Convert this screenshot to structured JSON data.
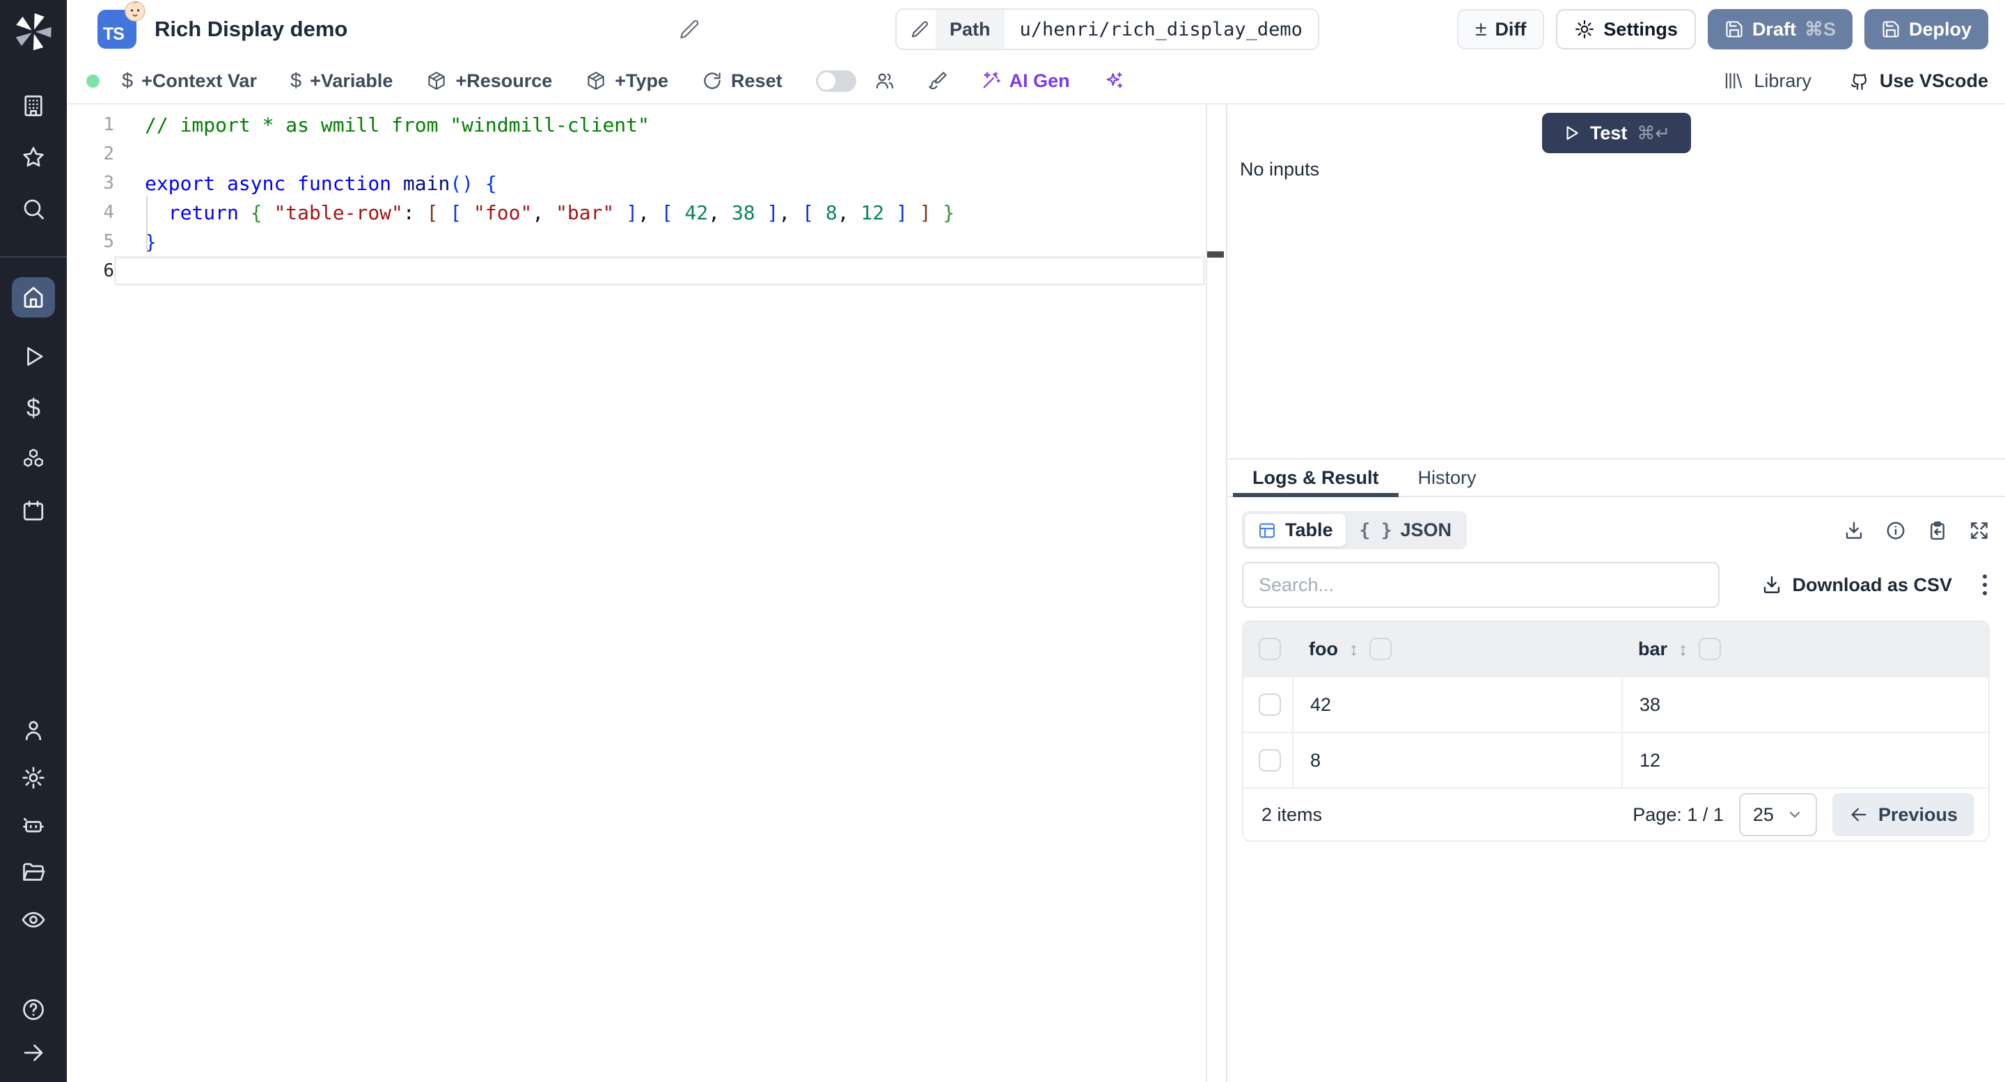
{
  "app": {
    "title": "Rich Display demo",
    "lang_badge": "TS"
  },
  "topbar": {
    "path_label": "Path",
    "path_value": "u/henri/rich_display_demo",
    "diff_label": "Diff",
    "settings_label": "Settings",
    "draft_label": "Draft",
    "draft_shortcut": "⌘S",
    "deploy_label": "Deploy"
  },
  "toolbar": {
    "context_var": "+Context Var",
    "variable": "+Variable",
    "resource": "+Resource",
    "type": "+Type",
    "reset": "Reset",
    "ai_gen": "AI Gen",
    "library": "Library",
    "vscode": "Use VScode"
  },
  "editor": {
    "token_colors": {
      "comment": "#008000",
      "kw": "#0000ff",
      "fn": "#001080",
      "str": "#a31515",
      "num": "#098658",
      "b1": "#0431fa",
      "b2": "#319331",
      "b3": "#7b3814",
      "plain": "#111111"
    },
    "lines": [
      {
        "num": "1",
        "active": false,
        "tokens": [
          [
            "// import * as wmill from \"windmill-client\"",
            "comment"
          ]
        ]
      },
      {
        "num": "2",
        "active": false,
        "tokens": []
      },
      {
        "num": "3",
        "active": false,
        "tokens": [
          [
            "export ",
            "kw"
          ],
          [
            "async ",
            "kw"
          ],
          [
            "function ",
            "kw"
          ],
          [
            "main",
            "fn"
          ],
          [
            "()",
            "b1"
          ],
          [
            " ",
            "plain"
          ],
          [
            "{",
            "b1"
          ]
        ]
      },
      {
        "num": "4",
        "active": false,
        "tokens": [
          [
            "  ",
            "plain"
          ],
          [
            "return",
            "kw"
          ],
          [
            " ",
            "plain"
          ],
          [
            "{",
            "b2"
          ],
          [
            " ",
            "plain"
          ],
          [
            "\"table-row\"",
            "str"
          ],
          [
            ":",
            "plain"
          ],
          [
            " ",
            "plain"
          ],
          [
            "[",
            "b3"
          ],
          [
            " ",
            "plain"
          ],
          [
            "[",
            "b1"
          ],
          [
            " ",
            "plain"
          ],
          [
            "\"foo\"",
            "str"
          ],
          [
            ",",
            "plain"
          ],
          [
            " ",
            "plain"
          ],
          [
            "\"bar\"",
            "str"
          ],
          [
            " ",
            "plain"
          ],
          [
            "]",
            "b1"
          ],
          [
            ",",
            "plain"
          ],
          [
            " ",
            "plain"
          ],
          [
            "[",
            "b1"
          ],
          [
            " ",
            "plain"
          ],
          [
            "42",
            "num"
          ],
          [
            ",",
            "plain"
          ],
          [
            " ",
            "plain"
          ],
          [
            "38",
            "num"
          ],
          [
            " ",
            "plain"
          ],
          [
            "]",
            "b1"
          ],
          [
            ",",
            "plain"
          ],
          [
            " ",
            "plain"
          ],
          [
            "[",
            "b1"
          ],
          [
            " ",
            "plain"
          ],
          [
            "8",
            "num"
          ],
          [
            ",",
            "plain"
          ],
          [
            " ",
            "plain"
          ],
          [
            "12",
            "num"
          ],
          [
            " ",
            "plain"
          ],
          [
            "]",
            "b1"
          ],
          [
            " ",
            "plain"
          ],
          [
            "]",
            "b3"
          ],
          [
            " ",
            "plain"
          ],
          [
            "}",
            "b2"
          ]
        ]
      },
      {
        "num": "5",
        "active": false,
        "tokens": [
          [
            "}",
            "b1"
          ]
        ]
      },
      {
        "num": "6",
        "active": true,
        "tokens": []
      }
    ]
  },
  "run_panel": {
    "test_label": "Test",
    "test_shortcut": "⌘↵",
    "no_inputs": "No inputs"
  },
  "result_panel": {
    "tabs": [
      {
        "label": "Logs & Result"
      },
      {
        "label": "History"
      }
    ],
    "view_toggle": [
      {
        "label": "Table"
      },
      {
        "label": "JSON"
      }
    ],
    "search_placeholder": "Search...",
    "download_csv_label": "Download as CSV",
    "table": {
      "columns": [
        "foo",
        "bar"
      ],
      "rows": [
        [
          "42",
          "38"
        ],
        [
          "8",
          "12"
        ]
      ],
      "items_text": "2 items",
      "page_text": "Page: 1 / 1",
      "page_size": "25",
      "previous_label": "Previous"
    }
  },
  "icons": {
    "sidebar": [
      "windmill-logo",
      "building-icon",
      "star-icon",
      "search-icon",
      "home-icon",
      "play-icon",
      "dollar-icon",
      "boxes-icon",
      "calendar-icon",
      "user-icon",
      "gear-icon",
      "robot-icon",
      "folder-icon",
      "eye-icon",
      "help-icon",
      "arrow-right-icon"
    ],
    "topbar": [
      "pencil-icon",
      "plus-minus-icon",
      "gear-icon",
      "save-icon"
    ],
    "toolbar": [
      "dollar-icon",
      "package-icon",
      "refresh-icon",
      "users-icon",
      "paintbrush-icon",
      "wand-icon",
      "sparkles-icon",
      "library-icon",
      "github-icon"
    ],
    "result": [
      "table-grid-icon",
      "braces-icon",
      "download-icon",
      "info-icon",
      "clipboard-copy-icon",
      "expand-icon",
      "sort-icon",
      "chevron-down-icon",
      "arrow-left-icon",
      "kebab-icon"
    ]
  },
  "colors": {
    "sidebar_bg": "#1e222d",
    "sidebar_active_bg": "#475a7c",
    "slate_button_bg": "#687ea2",
    "test_button_bg": "#323e59",
    "accent_purple": "#7c3aed",
    "status_green": "#7fe3a9",
    "ts_badge_blue": "#4276dd",
    "table_icon_blue": "#4d82e8"
  }
}
